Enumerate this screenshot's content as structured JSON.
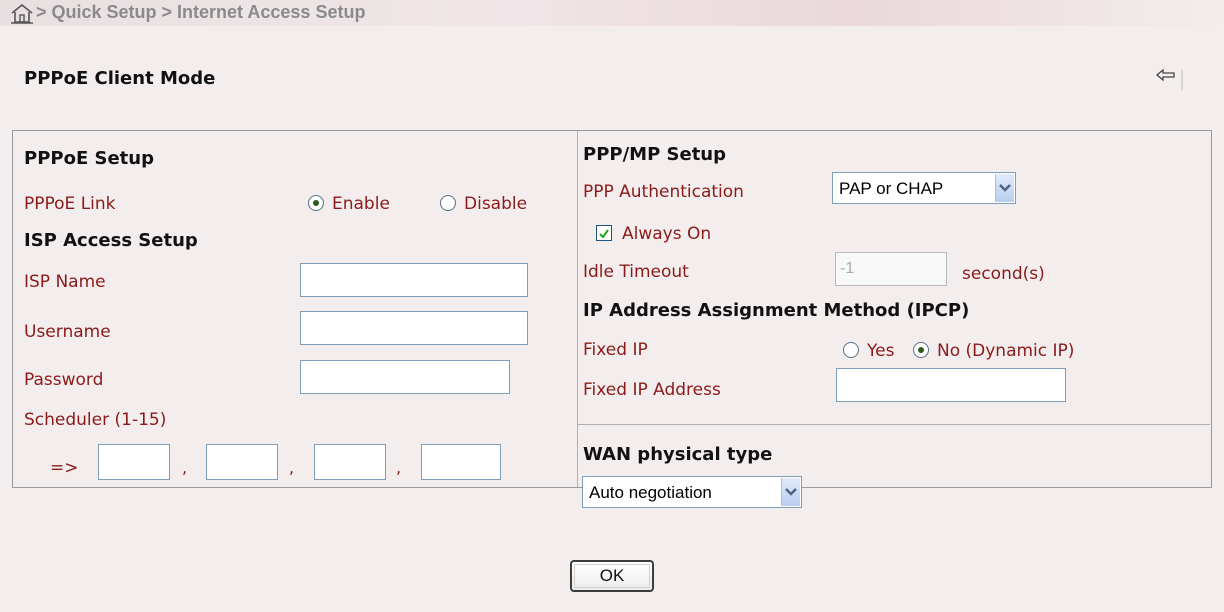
{
  "breadcrumb": {
    "text": "> Quick Setup > Internet Access Setup",
    "icon": "home-icon"
  },
  "page": {
    "title": "PPPoE Client Mode",
    "back_icon": "back-arrow-icon"
  },
  "left": {
    "pppoe_setup_heading": "PPPoE Setup",
    "pppoe_link_label": "PPPoE Link",
    "pppoe_link_enable": "Enable",
    "pppoe_link_disable": "Disable",
    "pppoe_link_selected": "Enable",
    "isp_heading": "ISP Access Setup",
    "isp_name_label": "ISP Name",
    "isp_name_value": "",
    "username_label": "Username",
    "username_value": "",
    "password_label": "Password",
    "password_value": "",
    "scheduler_label": "Scheduler (1-15)",
    "scheduler_arrow": "=>",
    "scheduler_values": [
      "",
      "",
      "",
      ""
    ],
    "scheduler_separator": ","
  },
  "right": {
    "ppp_heading": "PPP/MP Setup",
    "auth_label": "PPP Authentication",
    "auth_value": "PAP or CHAP",
    "always_on_label": "Always On",
    "always_on_checked": true,
    "idle_label": "Idle Timeout",
    "idle_value": "-1",
    "idle_unit": "second(s)",
    "ipcp_heading": "IP Address Assignment Method (IPCP)",
    "fixed_ip_label": "Fixed IP",
    "fixed_ip_yes": "Yes",
    "fixed_ip_no": "No (Dynamic IP)",
    "fixed_ip_selected": "No (Dynamic IP)",
    "fixed_ip_address_label": "Fixed IP Address",
    "fixed_ip_address_value": "",
    "wan_heading": "WAN physical type",
    "wan_value": "Auto negotiation"
  },
  "footer": {
    "ok_label": "OK"
  }
}
